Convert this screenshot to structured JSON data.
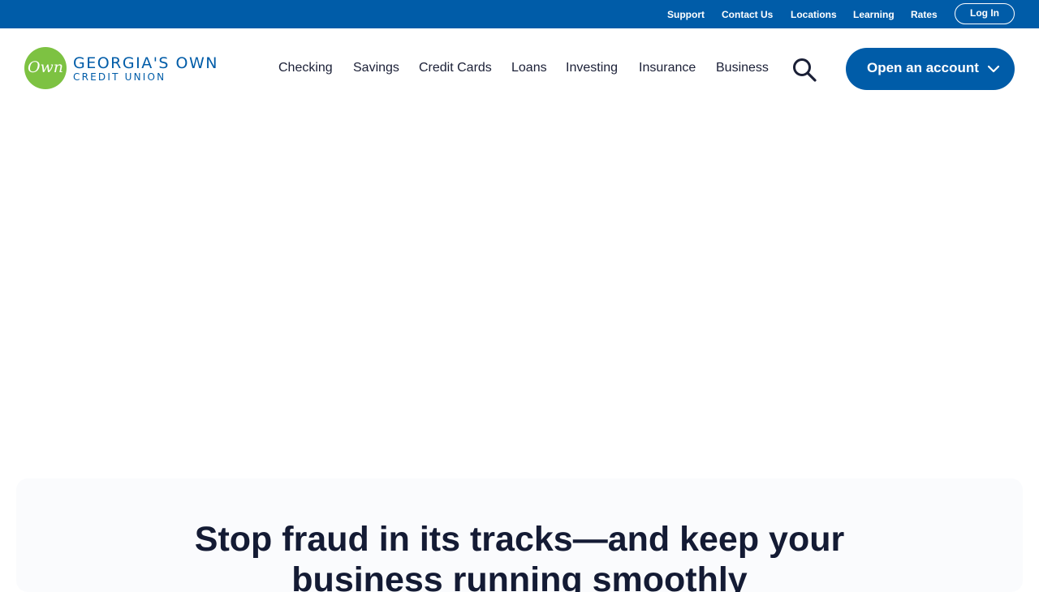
{
  "utility_nav": {
    "links": [
      "Support",
      "Contact Us",
      "Locations",
      "Learning",
      "Rates"
    ],
    "login_label": "Log In"
  },
  "logo": {
    "mark": "Own",
    "name_line1": "GEORGIA'S OWN",
    "name_line2": "CREDIT UNION"
  },
  "main_nav": {
    "items": [
      "Checking",
      "Savings",
      "Credit Cards",
      "Loans",
      "Investing",
      "Insurance",
      "Business"
    ],
    "search_icon": "search-icon",
    "cta_label": "Open an account",
    "cta_icon": "chevron-down-icon"
  },
  "feature": {
    "heading": "Stop fraud in its tracks—and keep your business running smoothly"
  },
  "colors": {
    "brand_blue": "#005ca8",
    "brand_green": "#7dc242",
    "text_dark": "#1a1f36",
    "section_bg": "#fafbfd"
  }
}
